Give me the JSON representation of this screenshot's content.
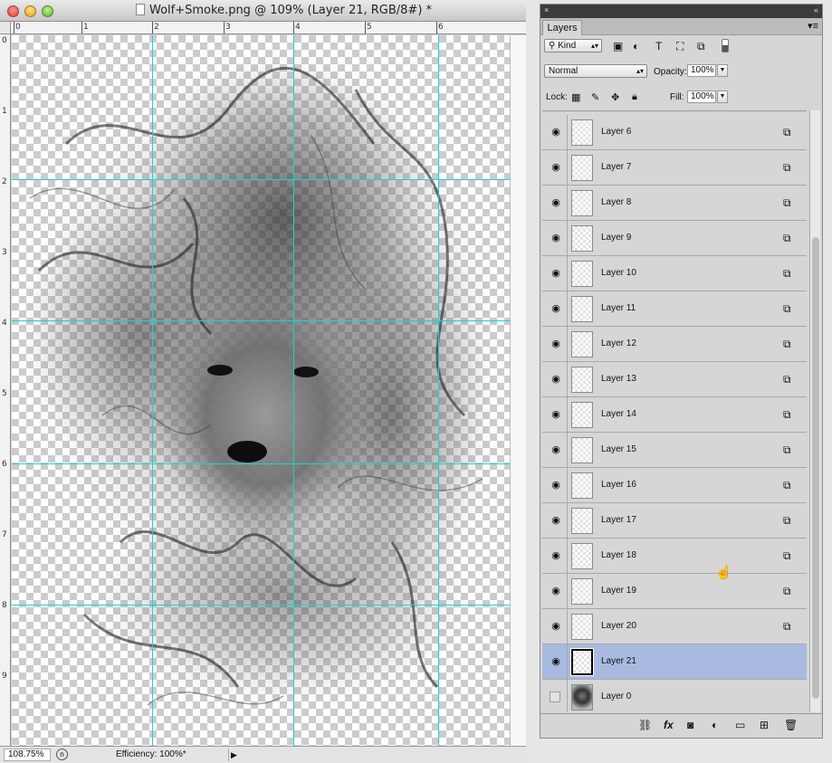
{
  "window": {
    "title": "Wolf+Smoke.png @ 109% (Layer 21, RGB/8#) *"
  },
  "rulers": {
    "top": [
      "0",
      "1",
      "2",
      "3",
      "4",
      "5",
      "6"
    ],
    "left": [
      "0",
      "1",
      "2",
      "3",
      "4",
      "5",
      "6",
      "7",
      "8",
      "9"
    ]
  },
  "status": {
    "zoom": "108.75%",
    "efficiency": "Efficiency: 100%*"
  },
  "panel": {
    "tab": "Layers",
    "filter_kind": "Kind",
    "blend_mode": "Normal",
    "opacity_label": "Opacity:",
    "opacity": "100%",
    "lock_label": "Lock:",
    "fill_label": "Fill:",
    "fill": "100%",
    "layers": [
      {
        "name": "Layer 6",
        "visible": true
      },
      {
        "name": "Layer 7",
        "visible": true
      },
      {
        "name": "Layer 8",
        "visible": true
      },
      {
        "name": "Layer 9",
        "visible": true
      },
      {
        "name": "Layer 10",
        "visible": true
      },
      {
        "name": "Layer 11",
        "visible": true
      },
      {
        "name": "Layer 12",
        "visible": true
      },
      {
        "name": "Layer 13",
        "visible": true
      },
      {
        "name": "Layer 14",
        "visible": true
      },
      {
        "name": "Layer 15",
        "visible": true
      },
      {
        "name": "Layer 16",
        "visible": true
      },
      {
        "name": "Layer 17",
        "visible": true
      },
      {
        "name": "Layer 18",
        "visible": true
      },
      {
        "name": "Layer 19",
        "visible": true
      },
      {
        "name": "Layer 20",
        "visible": true
      },
      {
        "name": "Layer 21",
        "visible": true,
        "selected": true
      },
      {
        "name": "Layer 0",
        "visible": false
      }
    ],
    "footer_icons": [
      "link-icon",
      "fx-icon",
      "mask-icon",
      "adjustment-icon",
      "folder-icon",
      "new-layer-icon",
      "trash-icon"
    ]
  },
  "colors": {
    "guide": "#18d4d4",
    "selection": "#a9bae0"
  }
}
